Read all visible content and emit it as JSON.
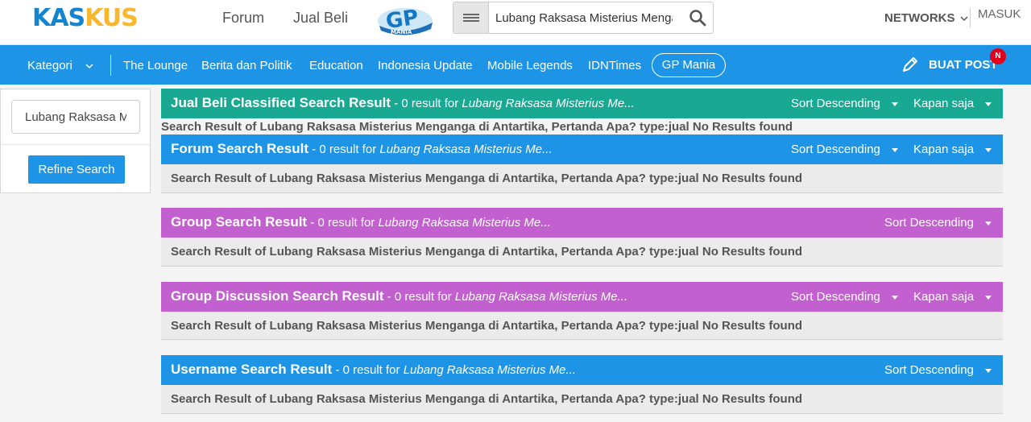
{
  "header": {
    "logo_part1": "KAS",
    "logo_part2": "KUS",
    "links": [
      "Forum",
      "Jual Beli"
    ],
    "gp_logo_text": "GP",
    "gp_logo_sub": "MANIA",
    "search_value": "Lubang Raksasa Misterius Menganga di Antartika, Pertanda Apa?",
    "networks_label": "NETWORKS",
    "masuk_label": "MASUK"
  },
  "nav": {
    "kategori_label": "Kategori",
    "items": [
      "The Lounge",
      "Berita dan Politik",
      "Education",
      "Indonesia Update",
      "Mobile Legends",
      "IDNTimes"
    ],
    "gp_mania_label": "GP Mania",
    "buat_post_label": "BUAT POST",
    "badge": "N"
  },
  "sidebar": {
    "refine_value": "Lubang Raksasa Misterius Menganga di Antartika, Pertanda Apa?",
    "refine_button": "Refine Search"
  },
  "colors": {
    "teal": "#19a891",
    "blue": "#1d94e6",
    "purple": "#c360cf"
  },
  "sections": [
    {
      "title": "Jual Beli Classified Search Result",
      "count_text": " - 0 result for ",
      "query": "Lubang Raksasa Misterius Me...",
      "sort": "Sort Descending",
      "kapan": "Kapan saja",
      "result": "Search Result of Lubang Raksasa Misterius Menganga di Antartika, Pertanda Apa? type:jual No Results found"
    },
    {
      "title": "Forum Search Result",
      "count_text": " - 0 result for ",
      "query": "Lubang Raksasa Misterius Me...",
      "sort": "Sort Descending",
      "kapan": "Kapan saja",
      "result": "Search Result of Lubang Raksasa Misterius Menganga di Antartika, Pertanda Apa? type:jual No Results found"
    },
    {
      "title": "Group Search Result",
      "count_text": " - 0 result for ",
      "query": "Lubang Raksasa Misterius Me...",
      "sort": "Sort Descending",
      "result": "Search Result of Lubang Raksasa Misterius Menganga di Antartika, Pertanda Apa? type:jual No Results found"
    },
    {
      "title": "Group Discussion Search Result",
      "count_text": " - 0 result for ",
      "query": "Lubang Raksasa Misterius Me...",
      "sort": "Sort Descending",
      "kapan": "Kapan saja",
      "result": "Search Result of Lubang Raksasa Misterius Menganga di Antartika, Pertanda Apa? type:jual No Results found"
    },
    {
      "title": "Username Search Result",
      "count_text": " - 0 result for ",
      "query": "Lubang Raksasa Misterius Me...",
      "sort": "Sort Descending",
      "result": "Search Result of Lubang Raksasa Misterius Menganga di Antartika, Pertanda Apa? type:jual No Results found"
    }
  ]
}
